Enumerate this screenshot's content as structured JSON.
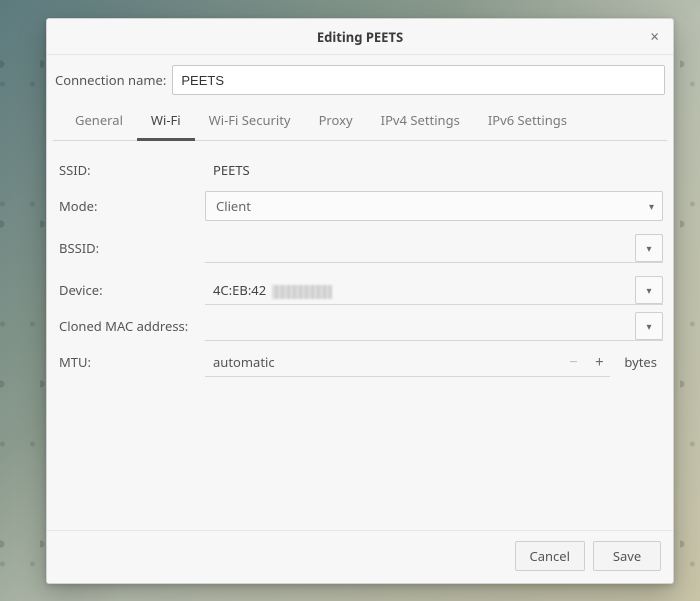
{
  "dialog": {
    "title": "Editing PEETS",
    "close_glyph": "×"
  },
  "connection_name": {
    "label": "Connection name:",
    "value": "PEETS"
  },
  "tabs": [
    {
      "label": "General",
      "active": false
    },
    {
      "label": "Wi-Fi",
      "active": true
    },
    {
      "label": "Wi-Fi Security",
      "active": false
    },
    {
      "label": "Proxy",
      "active": false
    },
    {
      "label": "IPv4 Settings",
      "active": false
    },
    {
      "label": "IPv6 Settings",
      "active": false
    }
  ],
  "wifi": {
    "ssid": {
      "label": "SSID:",
      "value": "PEETS"
    },
    "mode": {
      "label": "Mode:",
      "value": "Client"
    },
    "bssid": {
      "label": "BSSID:",
      "value": ""
    },
    "device": {
      "label": "Device:",
      "value_visible_prefix": "4C:EB:42",
      "value_obscured": true
    },
    "cloned_mac": {
      "label": "Cloned MAC address:",
      "value": ""
    },
    "mtu": {
      "label": "MTU:",
      "value": "automatic",
      "unit": "bytes",
      "minus_enabled": false,
      "plus_enabled": true
    }
  },
  "buttons": {
    "cancel": "Cancel",
    "save": "Save"
  },
  "glyphs": {
    "caret": "▾",
    "minus": "−",
    "plus": "+"
  }
}
